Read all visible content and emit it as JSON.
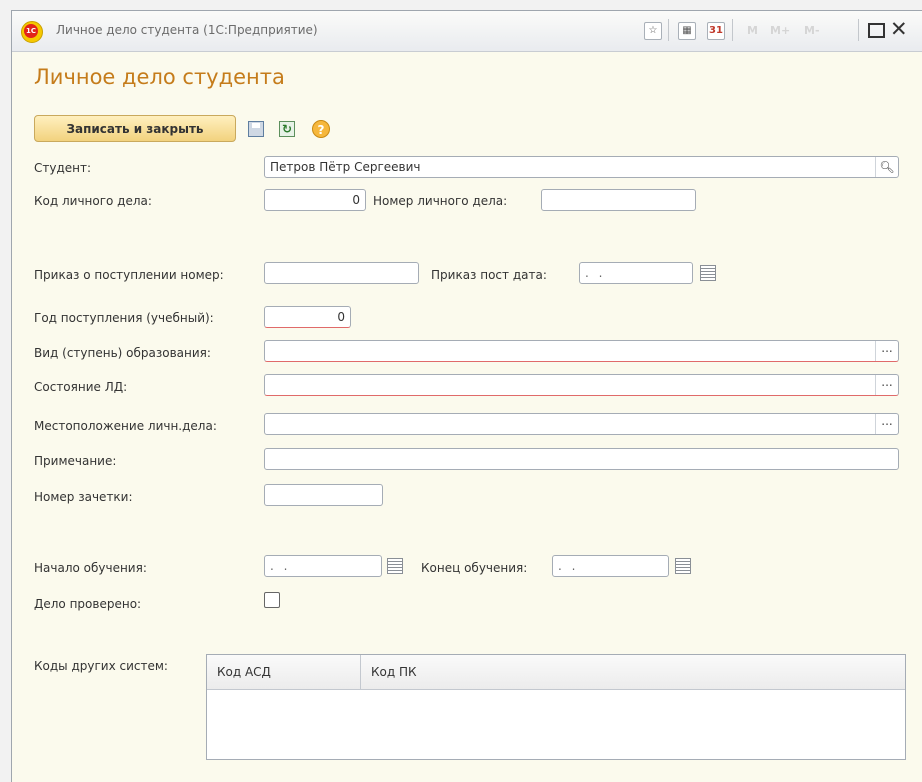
{
  "window": {
    "title": "Личное дело студента  (1С:Предприятие)",
    "logo_text": "1C",
    "memory_buttons": [
      "M",
      "M+",
      "M-"
    ]
  },
  "form": {
    "title": "Личное дело студента",
    "toolbar": {
      "write_close": "Записать и закрыть",
      "help": "?"
    },
    "fields": {
      "student": {
        "label": "Студент:",
        "value": "Петров Пётр Сергеевич"
      },
      "case_code": {
        "label": "Код личного дела:",
        "value": "0"
      },
      "case_number": {
        "label": "Номер личного дела:",
        "value": ""
      },
      "admission_order_number": {
        "label": "Приказ о поступлении номер:",
        "value": ""
      },
      "admission_order_date": {
        "label": "Приказ пост дата:",
        "value": " .  . "
      },
      "admission_year": {
        "label": "Год поступления (учебный):",
        "value": "0"
      },
      "education_level": {
        "label": "Вид (ступень) образования:",
        "value": "",
        "button": "..."
      },
      "case_state": {
        "label": "Состояние ЛД:",
        "value": "",
        "button": "..."
      },
      "case_location": {
        "label": "Местоположение личн.дела:",
        "value": "",
        "button": "..."
      },
      "note": {
        "label": "Примечание:",
        "value": ""
      },
      "record_book_number": {
        "label": "Номер зачетки:",
        "value": ""
      },
      "study_start": {
        "label": "Начало обучения:",
        "value": " .  . "
      },
      "study_end": {
        "label": "Конец обучения:",
        "value": " .  . "
      },
      "case_checked": {
        "label": "Дело проверено:",
        "checked": false
      }
    },
    "other_systems": {
      "label": "Коды других систем:",
      "columns": [
        "Код АСД",
        "Код ПК"
      ],
      "rows": []
    }
  }
}
